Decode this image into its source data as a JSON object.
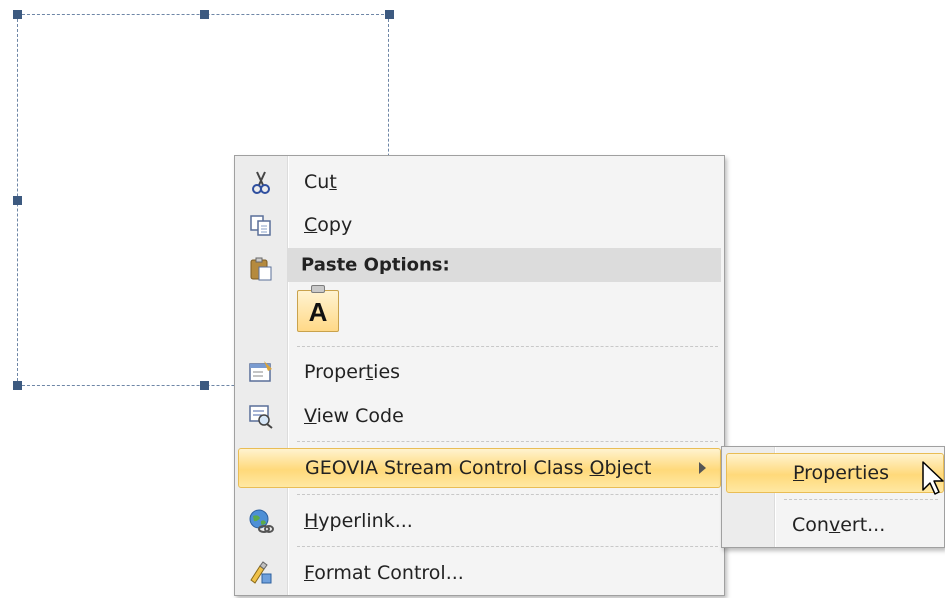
{
  "context_menu": {
    "items": [
      {
        "id": "cut",
        "pre": "Cu",
        "acc": "t",
        "post": "",
        "icon": "scissors-icon"
      },
      {
        "id": "copy",
        "pre": "",
        "acc": "C",
        "post": "opy",
        "icon": "copy-icon"
      },
      {
        "id": "paste_header",
        "text": "Paste Options:",
        "icon": "paste-clipboard-icon"
      },
      {
        "id": "paste_keep_text",
        "glyph": "A",
        "icon": "paste-keep-text-only-icon"
      },
      {
        "id": "properties",
        "pre": "Proper",
        "acc": "t",
        "post": "ies",
        "icon": "properties-icon"
      },
      {
        "id": "view_code",
        "pre": "",
        "acc": "V",
        "post": "iew Code",
        "icon": "view-code-icon"
      },
      {
        "id": "object",
        "pre": "GEOVIA Stream Control Class ",
        "acc": "O",
        "post": "bject",
        "icon": "submenu-arrow-icon"
      },
      {
        "id": "hyperlink",
        "pre": "",
        "acc": "H",
        "post": "yperlink...",
        "icon": "hyperlink-globe-icon"
      },
      {
        "id": "format_control",
        "pre": "",
        "acc": "F",
        "post": "ormat Control...",
        "icon": "format-control-icon"
      }
    ]
  },
  "submenu": {
    "items": [
      {
        "id": "sub_properties",
        "pre": "",
        "acc": "P",
        "post": "roperties"
      },
      {
        "id": "sub_convert",
        "pre": "Con",
        "acc": "v",
        "post": "ert..."
      }
    ]
  },
  "colors": {
    "highlight": "#ffd97a",
    "handle": "#3d5a80",
    "menu_bg": "#f4f4f4"
  }
}
